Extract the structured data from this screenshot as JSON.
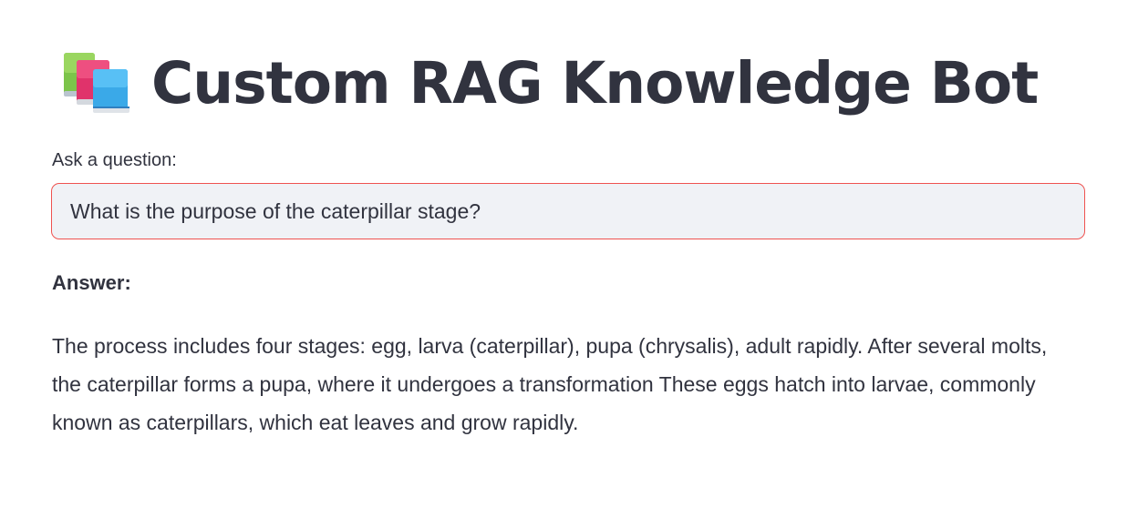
{
  "header": {
    "icon": "books-icon",
    "title": "Custom RAG Knowledge Bot"
  },
  "question": {
    "label": "Ask a question:",
    "value": "What is the purpose of the caterpillar stage?"
  },
  "answer": {
    "heading": "Answer:",
    "text": "The process includes four stages: egg, larva (caterpillar), pupa (chrysalis), adult rapidly. After several molts, the caterpillar forms a pupa, where it undergoes a transformation These eggs hatch into larvae, commonly known as caterpillars, which eat leaves and grow rapidly."
  },
  "colors": {
    "text": "#31333f",
    "input_background": "#f0f2f6",
    "input_border_focus": "#ef5350"
  }
}
